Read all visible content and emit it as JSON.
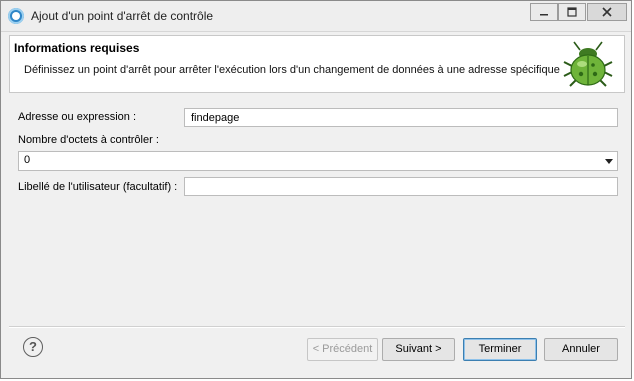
{
  "window": {
    "title": "Ajout d'un point d'arrêt de contrôle",
    "minimize_icon": "minimize-icon",
    "maximize_icon": "maximize-icon",
    "close_icon": "close-icon"
  },
  "header": {
    "title": "Informations requises",
    "description": "Définissez un point d'arrêt pour arrêter l'exécution lors d'un changement de données à une adresse spécifique",
    "icon": "bug-icon"
  },
  "form": {
    "address_label": "Adresse ou expression :",
    "address_value": "findepage",
    "bytes_label": "Nombre d'octets à contrôler :",
    "bytes_value": "0",
    "user_label_label": "Libellé de l'utilisateur (facultatif) :",
    "user_label_value": ""
  },
  "buttons": {
    "help_icon": "help-icon",
    "help_glyph": "?",
    "previous": "< Précédent",
    "next": "Suivant >",
    "finish": "Terminer",
    "cancel": "Annuler"
  },
  "colors": {
    "accent": "#3c7fb1",
    "title_bar": "#eeeeee",
    "dialog_bg": "#f0f0f0"
  }
}
